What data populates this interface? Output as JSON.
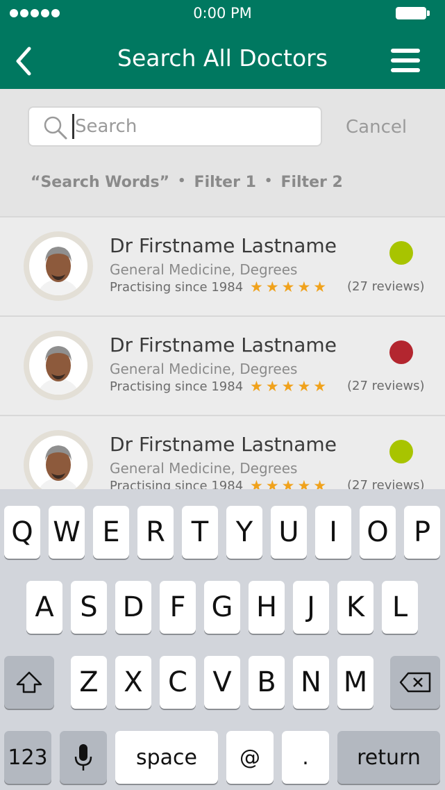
{
  "status_bar": {
    "time": "0:00 PM"
  },
  "header": {
    "title": "Search All Doctors"
  },
  "search": {
    "placeholder": "Search",
    "value": "",
    "cancel_label": "Cancel"
  },
  "filters": {
    "search_words": "“Search Words”",
    "filter1": "Filter 1",
    "filter2": "Filter 2",
    "separator": "•"
  },
  "doctors": [
    {
      "name": "Dr Firstname Lastname",
      "specialty": "General Medicine, Degrees",
      "practising": "Practising since 1984",
      "stars": "★★★★★",
      "rating": 5,
      "reviews": "(27 reviews)",
      "status_color": "#a8c400"
    },
    {
      "name": "Dr Firstname Lastname",
      "specialty": "General Medicine, Degrees",
      "practising": "Practising since 1984",
      "stars": "★★★★★",
      "rating": 5,
      "reviews": "(27 reviews)",
      "status_color": "#b3262f"
    },
    {
      "name": "Dr Firstname Lastname",
      "specialty": "General Medicine, Degrees",
      "practising": "Practising since 1984",
      "stars": "★★★★★",
      "rating": 5,
      "reviews": "(27 reviews)",
      "status_color": "#a8c400"
    }
  ],
  "keyboard": {
    "row1": [
      "Q",
      "W",
      "E",
      "R",
      "T",
      "Y",
      "U",
      "I",
      "O",
      "P"
    ],
    "row2": [
      "A",
      "S",
      "D",
      "F",
      "G",
      "H",
      "J",
      "K",
      "L"
    ],
    "row3": [
      "Z",
      "X",
      "C",
      "V",
      "B",
      "N",
      "M"
    ],
    "numbers": "123",
    "space": "space",
    "at": "@",
    "period": ".",
    "return": "return",
    "icons": [
      "shift-icon",
      "backspace-icon",
      "microphone-icon"
    ]
  },
  "colors": {
    "header": "#007860",
    "star": "#f0a21c",
    "status_available": "#a8c400",
    "status_busy": "#b3262f"
  }
}
